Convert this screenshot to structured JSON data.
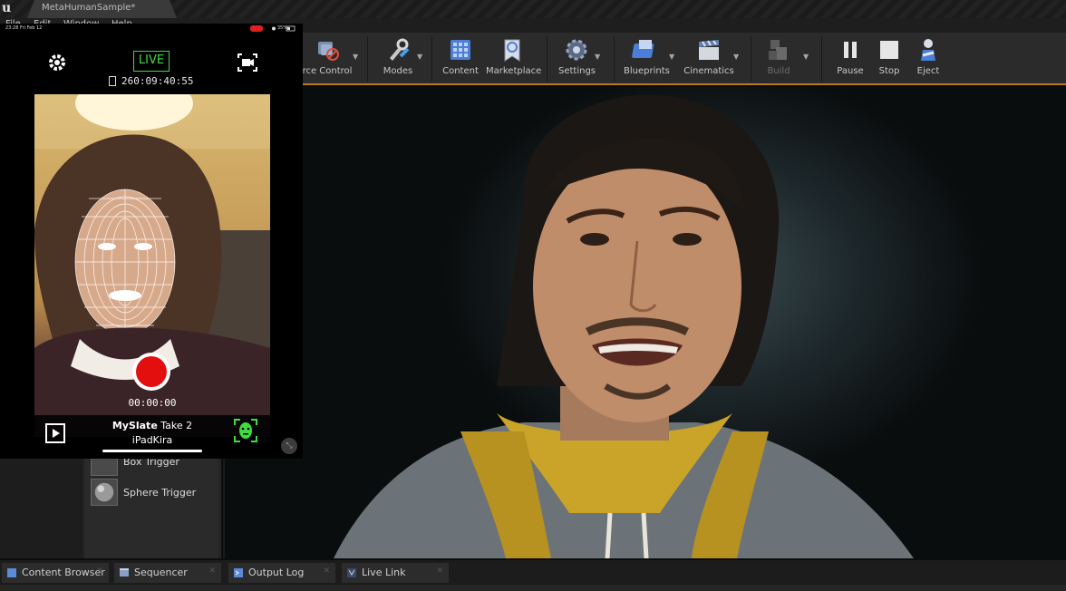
{
  "window": {
    "project_tab": "MetaHumanSample*"
  },
  "menu": [
    "File",
    "Edit",
    "Window",
    "Help"
  ],
  "toolbar": {
    "source_control": "rce Control",
    "modes": "Modes",
    "content": "Content",
    "marketplace": "Marketplace",
    "settings": "Settings",
    "blueprints": "Blueprints",
    "cinematics": "Cinematics",
    "build": "Build",
    "pause": "Pause",
    "stop": "Stop",
    "eject": "Eject"
  },
  "place_actors": {
    "items": [
      {
        "label": "Box Trigger"
      },
      {
        "label": "Sphere Trigger"
      }
    ]
  },
  "bottom_tabs": [
    {
      "label": "Content Browser"
    },
    {
      "label": "Sequencer"
    },
    {
      "label": "Output Log"
    },
    {
      "label": "Live Link"
    }
  ],
  "phone": {
    "status_time": "23:28",
    "status_date": "Fri Feb 12",
    "battery": "35%",
    "live_label": "LIVE",
    "timecode": "260:09:40:55",
    "record_time": "00:00:00",
    "slate_name": "MySlate",
    "take": "Take 2",
    "device_name": "iPadKira"
  },
  "colors": {
    "accent_live": "#3fdd3f",
    "record": "#e30f0f",
    "toolbar_underline": "#b77a1f"
  }
}
